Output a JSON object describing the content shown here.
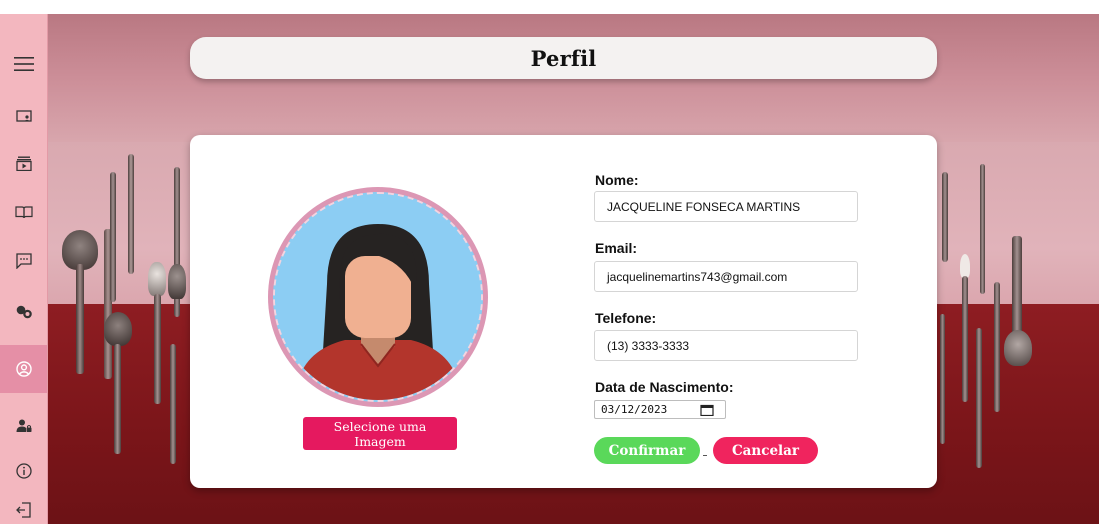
{
  "page": {
    "title": "Perfil"
  },
  "sidebar": {
    "items": [
      {
        "icon": "menu-icon",
        "active": false
      },
      {
        "icon": "presentation-icon",
        "active": false
      },
      {
        "icon": "video-library-icon",
        "active": false
      },
      {
        "icon": "book-icon",
        "active": false
      },
      {
        "icon": "chat-icon",
        "active": false
      },
      {
        "icon": "community-icon",
        "active": false
      },
      {
        "icon": "profile-icon",
        "active": true
      },
      {
        "icon": "user-settings-icon",
        "active": false
      },
      {
        "icon": "info-icon",
        "active": false
      },
      {
        "icon": "logout-icon",
        "active": false
      }
    ]
  },
  "profile": {
    "select_image_label": "Selecione uma Imagem",
    "name_label": "Nome:",
    "name_value": "JACQUELINE FONSECA MARTINS",
    "email_label": "Email:",
    "email_value": "jacquelinemartins743@gmail.com",
    "phone_label": "Telefone:",
    "phone_value": "(13) 3333-3333",
    "birth_label": "Data de Nascimento:",
    "birth_value": "03/12/2023",
    "confirm_label": "Confirmar",
    "cancel_label": "Cancelar"
  },
  "colors": {
    "sidebar_bg": "#f3b7bf",
    "sidebar_active": "#e58fa6",
    "select_button": "#e5195f",
    "confirm_button": "#5ad85a",
    "cancel_button": "#f0245e"
  }
}
